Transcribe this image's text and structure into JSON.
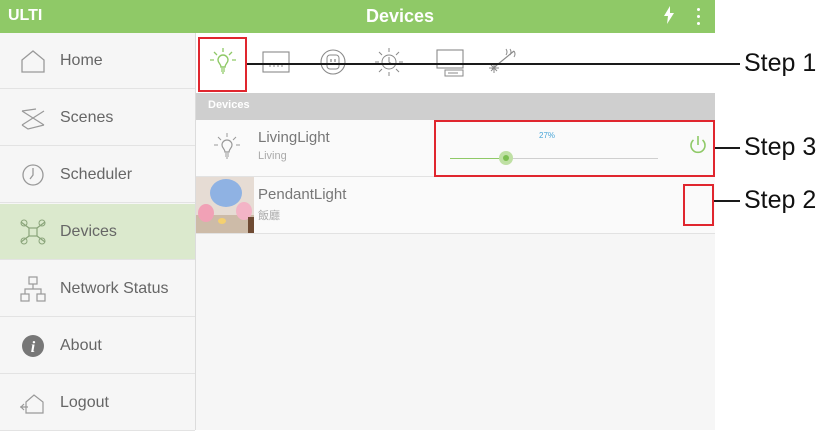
{
  "app": {
    "brand": "ULTI",
    "title": "Devices"
  },
  "sidebar": {
    "items": [
      {
        "label": "Home",
        "icon": "home-icon"
      },
      {
        "label": "Scenes",
        "icon": "scenes-icon"
      },
      {
        "label": "Scheduler",
        "icon": "clock-icon"
      },
      {
        "label": "Devices",
        "icon": "devices-icon",
        "active": true
      },
      {
        "label": "Network Status",
        "icon": "network-icon"
      },
      {
        "label": "About",
        "icon": "info-icon"
      },
      {
        "label": "Logout",
        "icon": "logout-icon"
      }
    ]
  },
  "categories": [
    "light-bulb-icon",
    "curtain-icon",
    "socket-icon",
    "dimmer-icon",
    "tv-icon",
    "aircon-icon"
  ],
  "section": {
    "label": "Devices"
  },
  "devices": [
    {
      "name": "LivingLight",
      "room": "Living",
      "level_percent": 27,
      "level_label": "27%"
    },
    {
      "name": "PendantLight",
      "room": "飯廳"
    }
  ],
  "annotations": {
    "step1": "Step 1",
    "step2": "Step 2",
    "step3": "Step 3"
  },
  "colors": {
    "accent": "#8fc967",
    "callout": "#e0262e",
    "active_nav": "#dbe9cd",
    "percent_text": "#4aa6d8"
  }
}
